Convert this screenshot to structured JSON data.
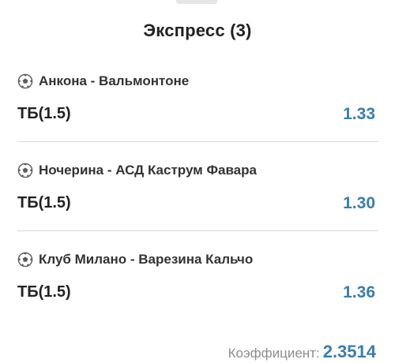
{
  "title": "Экспресс (3)",
  "bets": [
    {
      "icon": "soccer-ball-icon",
      "event": "Анкона - Вальмонтоне",
      "market": "ТБ(1.5)",
      "odds": "1.33"
    },
    {
      "icon": "soccer-ball-icon",
      "event": "Ночерина - АСД Каструм Фавара",
      "market": "ТБ(1.5)",
      "odds": "1.30"
    },
    {
      "icon": "soccer-ball-icon",
      "event": "Клуб Милано - Варезина Кальчо",
      "market": "ТБ(1.5)",
      "odds": "1.36"
    }
  ],
  "footer": {
    "label": "Коэффициент:",
    "value": "2.3514"
  },
  "colors": {
    "accent": "#3a7dae",
    "text": "#222222",
    "muted": "#8d8d8d",
    "divider": "#d9d9d9"
  }
}
